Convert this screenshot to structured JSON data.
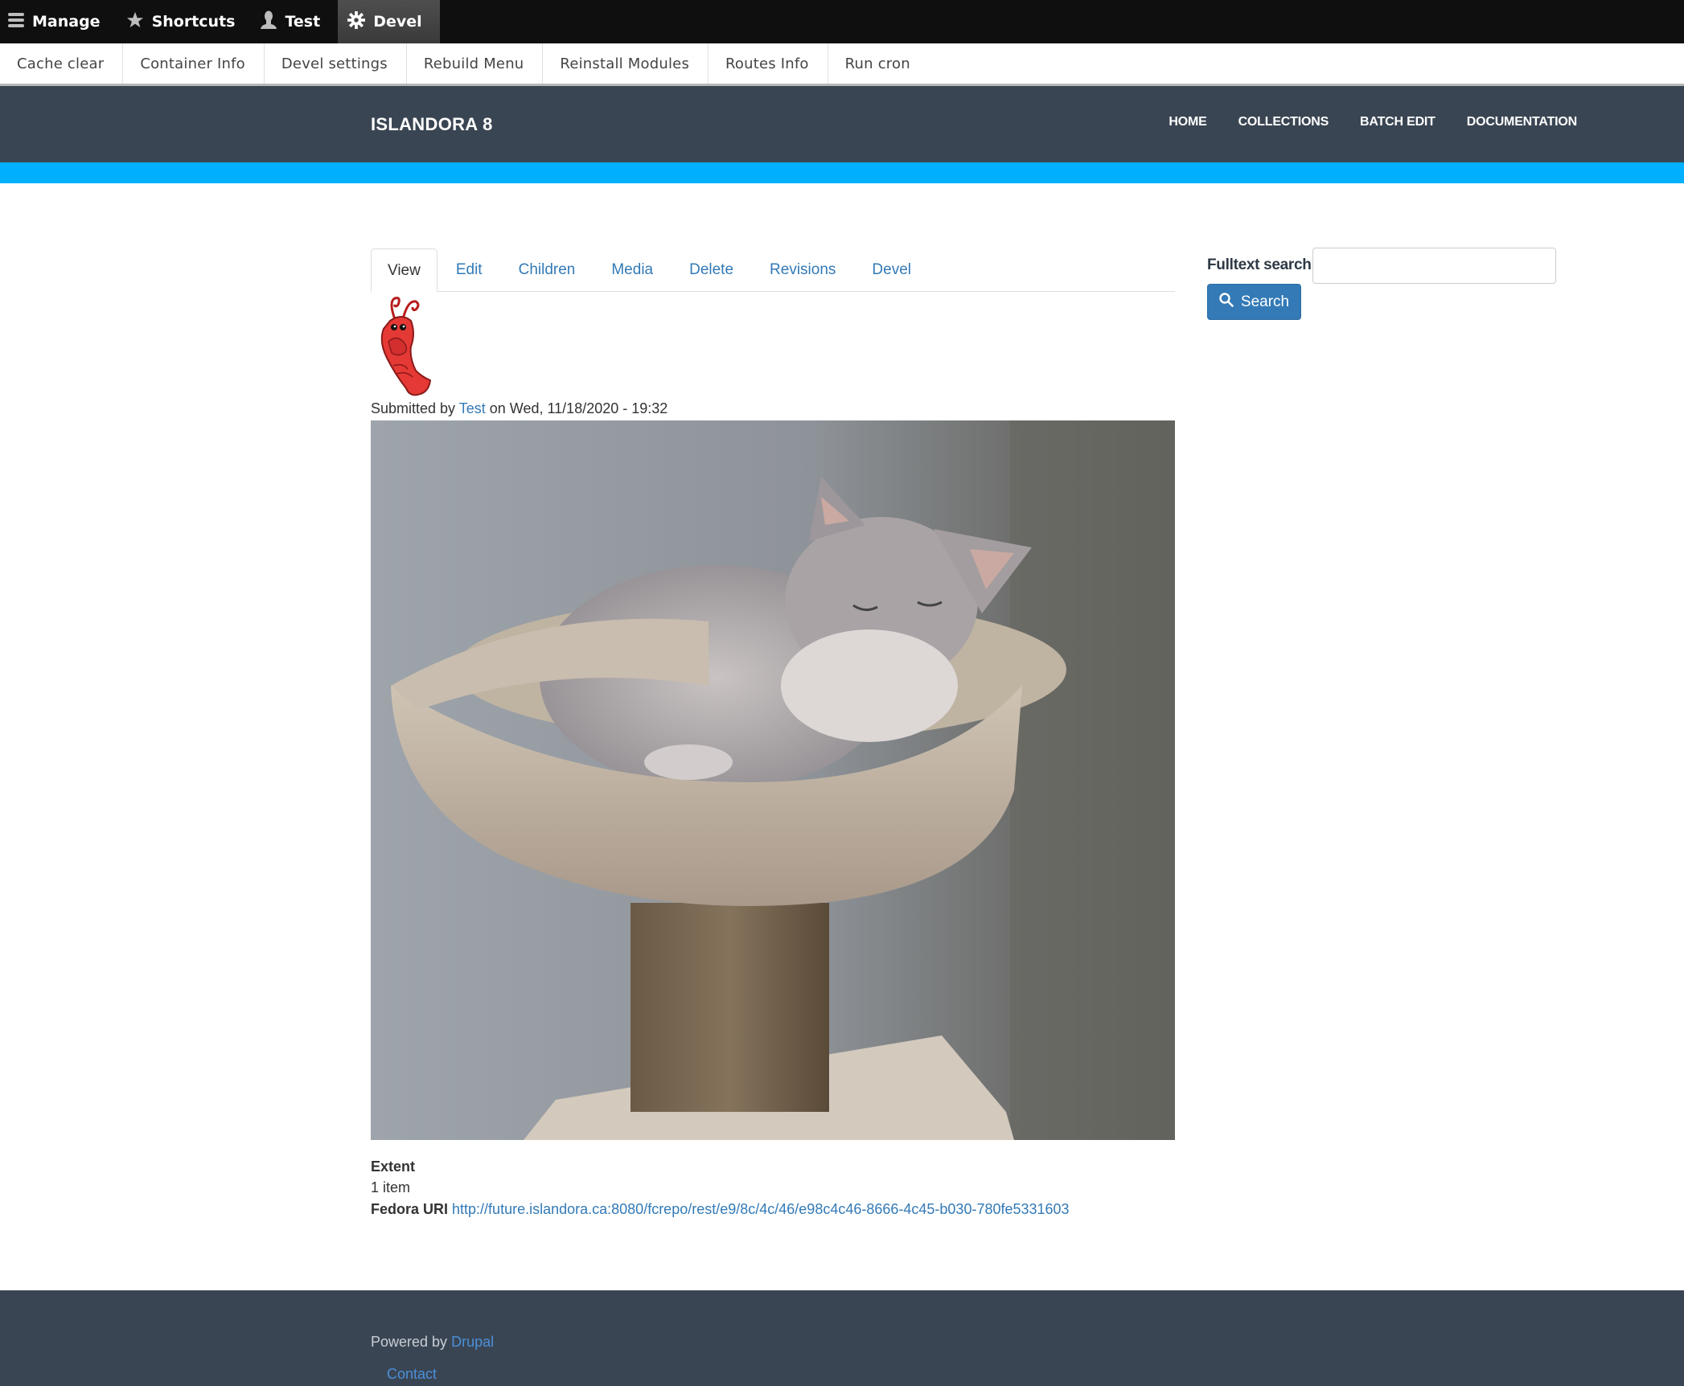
{
  "toolbar": {
    "items": [
      {
        "label": "Manage",
        "icon": "hamburger-icon"
      },
      {
        "label": "Shortcuts",
        "icon": "star-icon"
      },
      {
        "label": "Test",
        "icon": "user-icon"
      },
      {
        "label": "Devel",
        "icon": "gear-icon",
        "active": true
      }
    ]
  },
  "devel_tray": {
    "items": [
      "Cache clear",
      "Container Info",
      "Devel settings",
      "Rebuild Menu",
      "Reinstall Modules",
      "Routes Info",
      "Run cron"
    ]
  },
  "header": {
    "site_name": "ISLANDORA 8",
    "nav": [
      "HOME",
      "COLLECTIONS",
      "BATCH EDIT",
      "DOCUMENTATION"
    ],
    "accent_color": "#00b0ff",
    "background_color": "#3a4553"
  },
  "tabs": [
    {
      "label": "View",
      "active": true
    },
    {
      "label": "Edit"
    },
    {
      "label": "Children"
    },
    {
      "label": "Media"
    },
    {
      "label": "Delete"
    },
    {
      "label": "Revisions"
    },
    {
      "label": "Devel"
    }
  ],
  "node": {
    "logo_alt": "lobster-logo",
    "submitted_prefix": "Submitted by",
    "author": "Test",
    "submitted_suffix": "on Wed, 11/18/2020 - 19:32",
    "image_alt": "Grey cat sleeping in a carpeted cat tree bed",
    "fields": {
      "extent_label": "Extent",
      "extent_value": "1 item",
      "fedora_uri_label": "Fedora URI",
      "fedora_uri_value": "http://future.islandora.ca:8080/fcrepo/rest/e9/8c/4c/46/e98c4c46-8666-4c45-b030-780fe5331603"
    }
  },
  "sidebar": {
    "search_label": "Fulltext search",
    "search_value": "",
    "search_placeholder": "",
    "search_button": "Search"
  },
  "footer": {
    "powered_prefix": "Powered by",
    "powered_link": "Drupal",
    "contact": "Contact"
  }
}
